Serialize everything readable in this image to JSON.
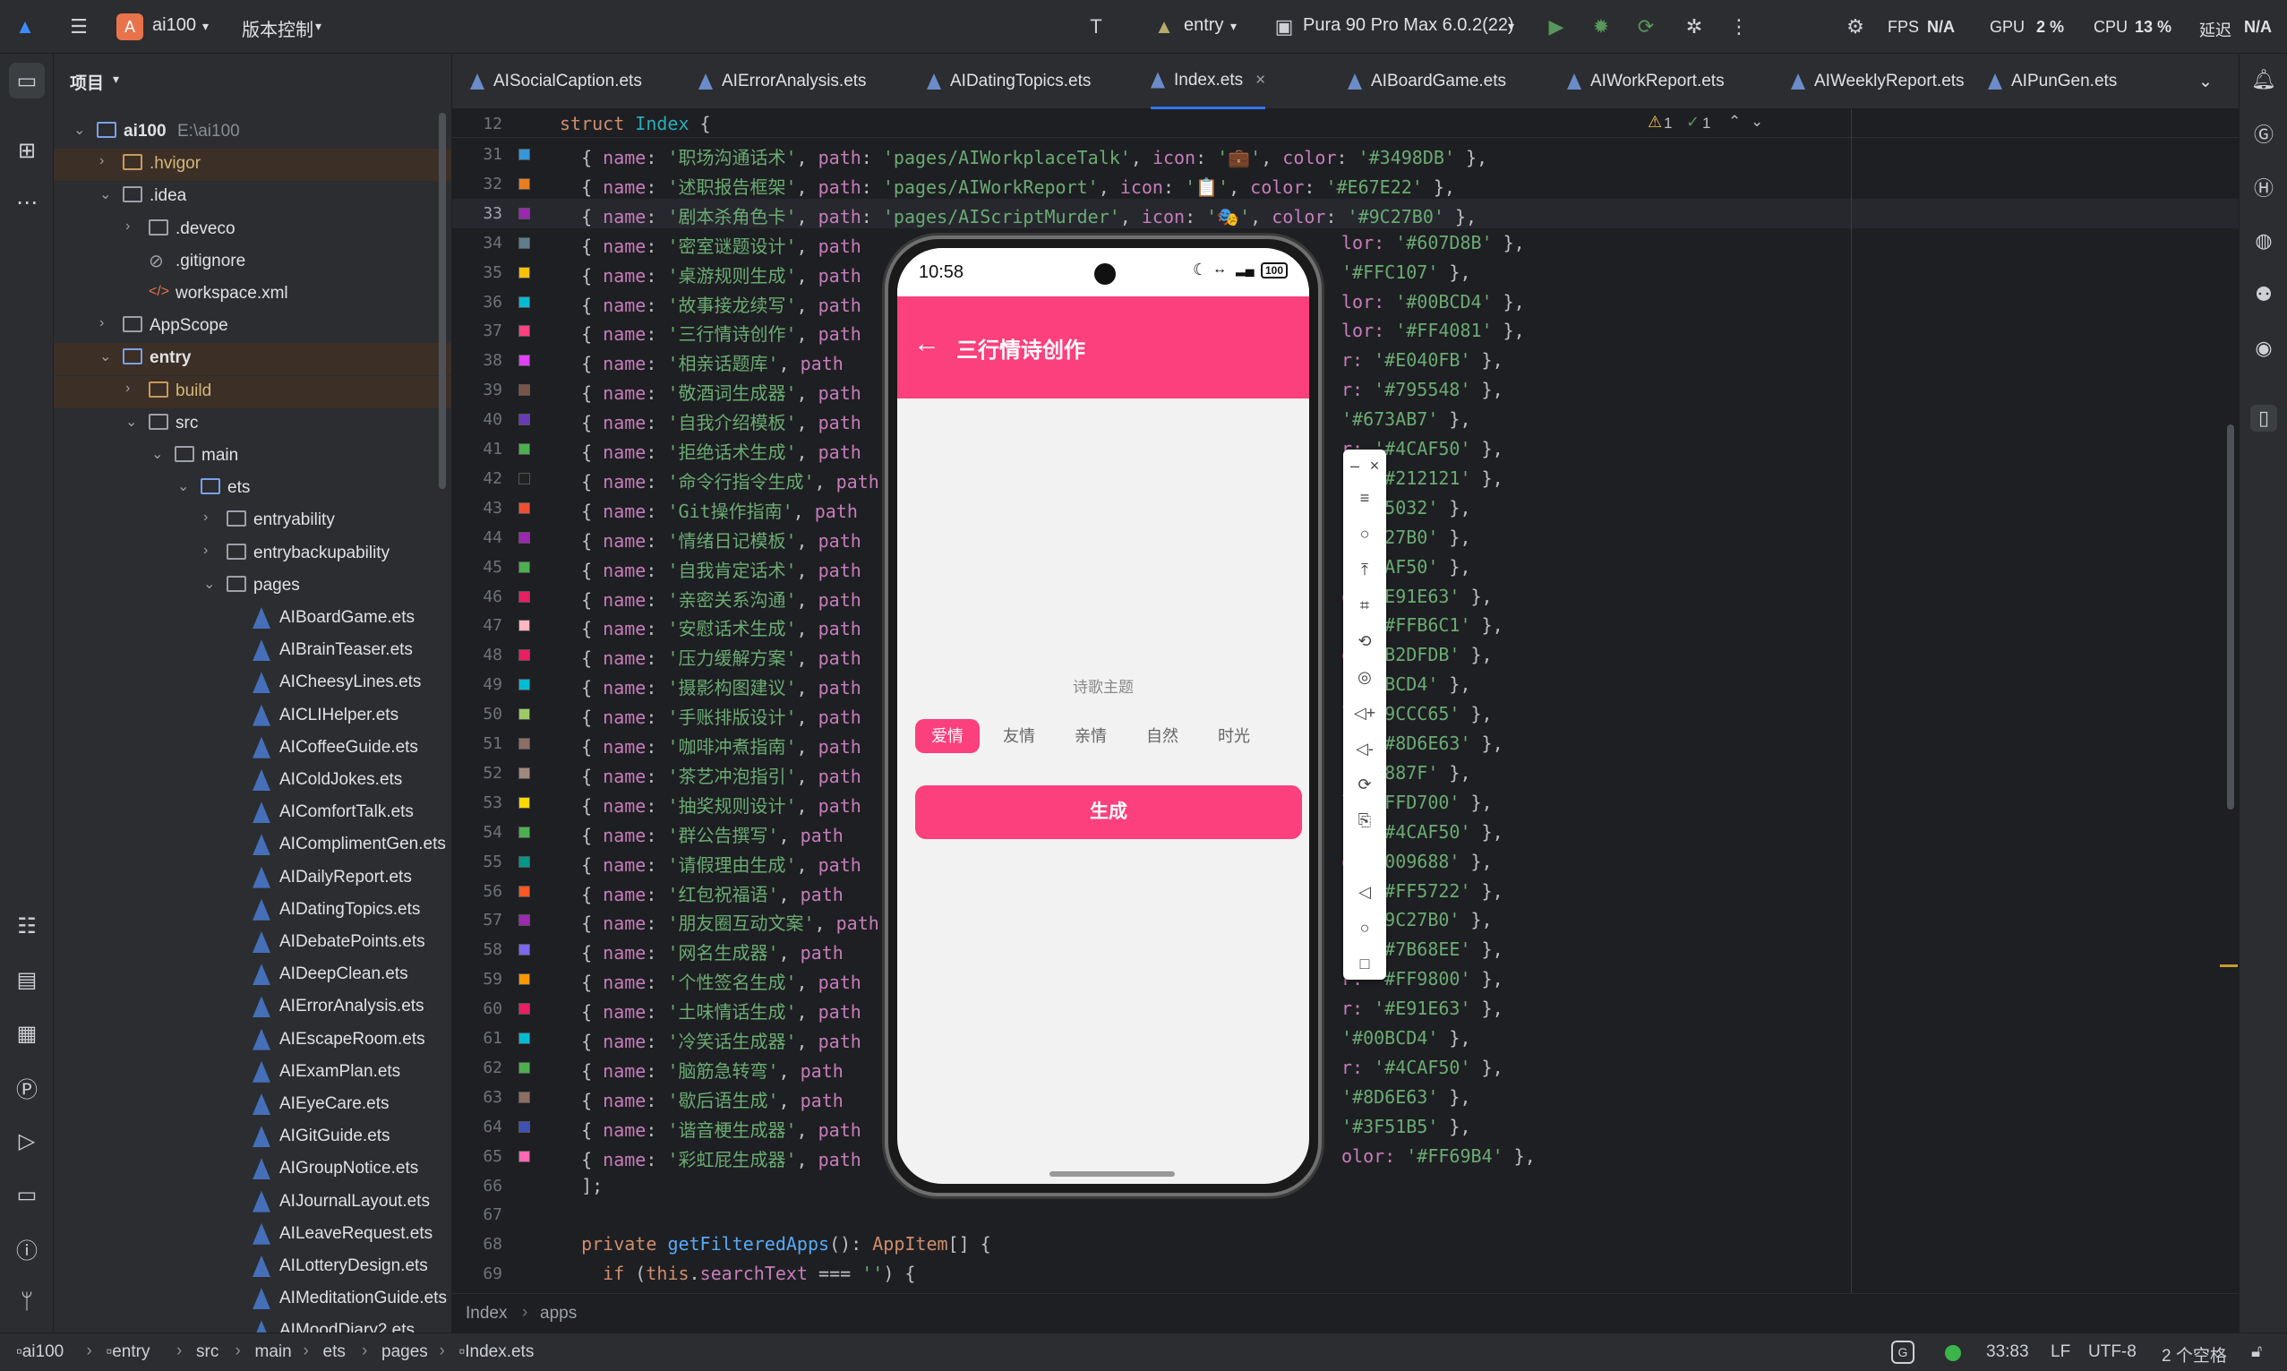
{
  "topbar": {
    "project": "ai100",
    "project_initial": "A",
    "vcs": "版本控制",
    "module": "entry",
    "device": "Pura 90 Pro Max 6.0.2(22)",
    "fps_label": "FPS",
    "fps_value": "N/A",
    "gpu_label": "GPU",
    "gpu_value": "2 %",
    "cpu_label": "CPU",
    "cpu_value": "13 %",
    "latency_label": "延迟",
    "latency_value": "N/A"
  },
  "project_panel": {
    "title": "项目",
    "root_name": "ai100",
    "root_path": "E:\\ai100",
    "items": [
      {
        "label": "ai100",
        "level": 0,
        "type": "root"
      },
      {
        "label": ".hvigor",
        "level": 1,
        "type": "folder-orange",
        "collapsed": true
      },
      {
        "label": ".idea",
        "level": 1,
        "type": "folder",
        "collapsed": false
      },
      {
        "label": ".deveco",
        "level": 2,
        "type": "folder",
        "collapsed": true
      },
      {
        "label": ".gitignore",
        "level": 2,
        "type": "ignore"
      },
      {
        "label": "workspace.xml",
        "level": 2,
        "type": "xml"
      },
      {
        "label": "AppScope",
        "level": 1,
        "type": "folder",
        "collapsed": true
      },
      {
        "label": "entry",
        "level": 1,
        "type": "module",
        "collapsed": false
      },
      {
        "label": "build",
        "level": 2,
        "type": "folder-orange",
        "collapsed": true
      },
      {
        "label": "src",
        "level": 2,
        "type": "folder",
        "collapsed": false
      },
      {
        "label": "main",
        "level": 3,
        "type": "folder",
        "collapsed": false
      },
      {
        "label": "ets",
        "level": 4,
        "type": "folder-blue",
        "collapsed": false
      },
      {
        "label": "entryability",
        "level": 5,
        "type": "folder",
        "collapsed": true
      },
      {
        "label": "entrybackupability",
        "level": 5,
        "type": "folder",
        "collapsed": true
      },
      {
        "label": "pages",
        "level": 5,
        "type": "folder",
        "collapsed": false
      },
      {
        "label": "AIBoardGame.ets",
        "level": 6,
        "type": "file"
      },
      {
        "label": "AIBrainTeaser.ets",
        "level": 6,
        "type": "file"
      },
      {
        "label": "AICheesyLines.ets",
        "level": 6,
        "type": "file"
      },
      {
        "label": "AICLIHelper.ets",
        "level": 6,
        "type": "file"
      },
      {
        "label": "AICoffeeGuide.ets",
        "level": 6,
        "type": "file"
      },
      {
        "label": "AIColdJokes.ets",
        "level": 6,
        "type": "file"
      },
      {
        "label": "AIComfortTalk.ets",
        "level": 6,
        "type": "file"
      },
      {
        "label": "AIComplimentGen.ets",
        "level": 6,
        "type": "file"
      },
      {
        "label": "AIDailyReport.ets",
        "level": 6,
        "type": "file"
      },
      {
        "label": "AIDatingTopics.ets",
        "level": 6,
        "type": "file"
      },
      {
        "label": "AIDebatePoints.ets",
        "level": 6,
        "type": "file"
      },
      {
        "label": "AIDeepClean.ets",
        "level": 6,
        "type": "file"
      },
      {
        "label": "AIErrorAnalysis.ets",
        "level": 6,
        "type": "file"
      },
      {
        "label": "AIEscapeRoom.ets",
        "level": 6,
        "type": "file"
      },
      {
        "label": "AIExamPlan.ets",
        "level": 6,
        "type": "file"
      },
      {
        "label": "AIEyeCare.ets",
        "level": 6,
        "type": "file"
      },
      {
        "label": "AIGitGuide.ets",
        "level": 6,
        "type": "file"
      },
      {
        "label": "AIGroupNotice.ets",
        "level": 6,
        "type": "file"
      },
      {
        "label": "AIJournalLayout.ets",
        "level": 6,
        "type": "file"
      },
      {
        "label": "AILeaveRequest.ets",
        "level": 6,
        "type": "file"
      },
      {
        "label": "AILotteryDesign.ets",
        "level": 6,
        "type": "file"
      },
      {
        "label": "AIMeditationGuide.ets",
        "level": 6,
        "type": "file"
      },
      {
        "label": "AIMoodDiary2.ets",
        "level": 6,
        "type": "file"
      }
    ]
  },
  "tabs": [
    {
      "label": "AISocialCaption.ets",
      "active": false
    },
    {
      "label": "AIErrorAnalysis.ets",
      "active": false
    },
    {
      "label": "AIDatingTopics.ets",
      "active": false
    },
    {
      "label": "Index.ets",
      "active": true
    },
    {
      "label": "AIBoardGame.ets",
      "active": false
    },
    {
      "label": "AIWorkReport.ets",
      "active": false
    },
    {
      "label": "AIWeeklyReport.ets",
      "active": false
    },
    {
      "label": "AIPunGen.ets",
      "active": false
    }
  ],
  "inspections": {
    "warnings": "1",
    "ok": "1"
  },
  "editor": {
    "sticky_line": {
      "num": "12",
      "kw": "struct",
      "name": "Index",
      "rest": " {"
    },
    "lines": [
      {
        "num": "31",
        "color": "#3498DB",
        "name": "'职场沟通话术'",
        "path": "'pages/AIWorkplaceTalk'",
        "icon": "💼",
        "color_str": "'#3498DB'"
      },
      {
        "num": "32",
        "color": "#E67E22",
        "name": "'述职报告框架'",
        "path": "'pages/AIWorkReport'",
        "icon": "📋",
        "color_str": "'#E67E22'"
      },
      {
        "num": "33",
        "color": "#9C27B0",
        "name": "'剧本杀角色卡'",
        "path": "'pages/AIScriptMurder'",
        "icon": "🎭",
        "color_str": "'#9C27B0'"
      },
      {
        "num": "34",
        "color": "#607D8B",
        "name": "'密室谜题设计'",
        "color_str": "'#607D8B'",
        "tail": "lor: "
      },
      {
        "num": "35",
        "color": "#FFC107",
        "name": "'桌游规则生成'",
        "color_str": "'#FFC107'",
        "tail": ""
      },
      {
        "num": "36",
        "color": "#00BCD4",
        "name": "'故事接龙续写'",
        "color_str": "'#00BCD4'",
        "tail": "lor: "
      },
      {
        "num": "37",
        "color": "#FF4081",
        "name": "'三行情诗创作'",
        "color_str": "'#FF4081'",
        "tail": "lor: "
      },
      {
        "num": "38",
        "color": "#E040FB",
        "name": "'相亲话题库'",
        "color_str": "'#E040FB'",
        "tail": "r: "
      },
      {
        "num": "39",
        "color": "#795548",
        "name": "'敬酒词生成器'",
        "color_str": "'#795548'",
        "tail": "r: "
      },
      {
        "num": "40",
        "color": "#673AB7",
        "name": "'自我介绍模板'",
        "color_str": "'#673AB7'",
        "tail": ""
      },
      {
        "num": "41",
        "color": "#4CAF50",
        "name": "'拒绝话术生成'",
        "color_str": "'#4CAF50'",
        "tail": "r: "
      },
      {
        "num": "42",
        "color": "#212121",
        "name": "'命令行指令生成'",
        "color_str": "'#212121'",
        "tail": "r: "
      },
      {
        "num": "43",
        "color": "#F05032",
        "name": "'Git操作指南'",
        "color_str": "'#F05032'",
        "tail": ""
      },
      {
        "num": "44",
        "color": "#9C27B0",
        "name": "'情绪日记模板'",
        "color_str": "'#9C27B0'",
        "tail": ""
      },
      {
        "num": "45",
        "color": "#4CAF50",
        "name": "'自我肯定话术'",
        "color_str": "'#4CAF50'",
        "tail": ""
      },
      {
        "num": "46",
        "color": "#E91E63",
        "name": "'亲密关系沟通'",
        "color_str": "'#E91E63'",
        "tail": "or"
      },
      {
        "num": "47",
        "color": "#FFB6C1",
        "name": "'安慰话术生成'",
        "color_str": "'#FFB6C1'",
        "tail": "r: "
      },
      {
        "num": "48",
        "color": "#E91E63",
        "name": "'压力缓解方案'",
        "color_str": "'#B2DFDB'",
        "tail": "or"
      },
      {
        "num": "49",
        "color": "#00BCD4",
        "name": "'摄影构图建议'",
        "color_str": "'#00BCD4'",
        "tail": ""
      },
      {
        "num": "50",
        "color": "#9CCC65",
        "name": "'手账排版设计'",
        "color_str": "'#9CCC65'",
        "tail": "lo"
      },
      {
        "num": "51",
        "color": "#8D6E63",
        "name": "'咖啡冲煮指南'",
        "color_str": "'#8D6E63'",
        "tail": "r: "
      },
      {
        "num": "52",
        "color": "#A1887F",
        "name": "'茶艺冲泡指引'",
        "color_str": "'#A1887F'",
        "tail": ""
      },
      {
        "num": "53",
        "color": "#FFD700",
        "name": "'抽奖规则设计'",
        "color_str": "'#FFD700'",
        "tail": "lo"
      },
      {
        "num": "54",
        "color": "#4CAF50",
        "name": "'群公告撰写'",
        "color_str": "'#4CAF50'",
        "tail": "r: "
      },
      {
        "num": "55",
        "color": "#009688",
        "name": "'请假理由生成'",
        "color_str": "'#009688'",
        "tail": "or"
      },
      {
        "num": "56",
        "color": "#FF5722",
        "name": "'红包祝福语'",
        "color_str": "'#FF5722'",
        "tail": "r: "
      },
      {
        "num": "57",
        "color": "#9C27B0",
        "name": "'朋友圈互动文案'",
        "color_str": "'#9C27B0'",
        "tail": "co"
      },
      {
        "num": "58",
        "color": "#7B68EE",
        "name": "'网名生成器'",
        "color_str": "'#7B68EE'",
        "tail": "r: "
      },
      {
        "num": "59",
        "color": "#FF9800",
        "name": "'个性签名生成'",
        "color_str": "'#FF9800'",
        "tail": "r: "
      },
      {
        "num": "60",
        "color": "#E91E63",
        "name": "'土味情话生成'",
        "color_str": "'#E91E63'",
        "tail": "r: "
      },
      {
        "num": "61",
        "color": "#00BCD4",
        "name": "'冷笑话生成器'",
        "color_str": "'#00BCD4'",
        "tail": ""
      },
      {
        "num": "62",
        "color": "#4CAF50",
        "name": "'脑筋急转弯'",
        "color_str": "'#4CAF50'",
        "tail": "r: "
      },
      {
        "num": "63",
        "color": "#8D6E63",
        "name": "'歇后语生成'",
        "color_str": "'#8D6E63'",
        "tail": ""
      },
      {
        "num": "64",
        "color": "#3F51B5",
        "name": "'谐音梗生成器'",
        "color_str": "'#3F51B5'",
        "tail": ""
      },
      {
        "num": "65",
        "color": "#FF69B4",
        "name": "'彩虹屁生成器'",
        "color_str": "'#FF69B4'",
        "tail": "olor: "
      }
    ],
    "tail_lines": [
      {
        "num": "66",
        "text": "];"
      },
      {
        "num": "67",
        "text": ""
      },
      {
        "num": "68",
        "text": "private getFilteredApps(): AppItem[] {"
      },
      {
        "num": "69",
        "text": "if (this.searchText === '') {"
      }
    ]
  },
  "phone": {
    "time": "10:58",
    "battery": "100",
    "title": "三行情诗创作",
    "theme_label": "诗歌主题",
    "chips": [
      "爱情",
      "友情",
      "亲情",
      "自然",
      "时光"
    ],
    "selected_chip": "爱情",
    "generate": "生成",
    "accent": "#FC3F7D"
  },
  "breadcrumb_code": [
    "Index",
    "apps"
  ],
  "status": {
    "path": [
      "ai100",
      "entry",
      "src",
      "main",
      "ets",
      "pages",
      "Index.ets"
    ],
    "position": "33:83",
    "line_sep": "LF",
    "encoding": "UTF-8",
    "indent": "2 个空格"
  }
}
